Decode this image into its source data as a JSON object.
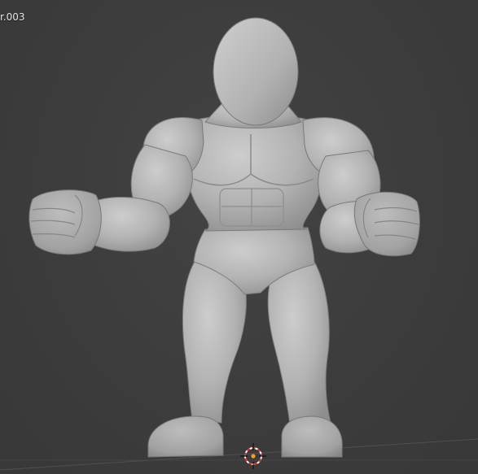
{
  "viewport": {
    "object_label": "r.003",
    "background_color": "#3d3d3d"
  },
  "model": {
    "type": "sculpt-mesh",
    "name": "muscular-character",
    "color": "#b4b4b4"
  },
  "icons": {
    "cursor": "3d-cursor-icon"
  }
}
